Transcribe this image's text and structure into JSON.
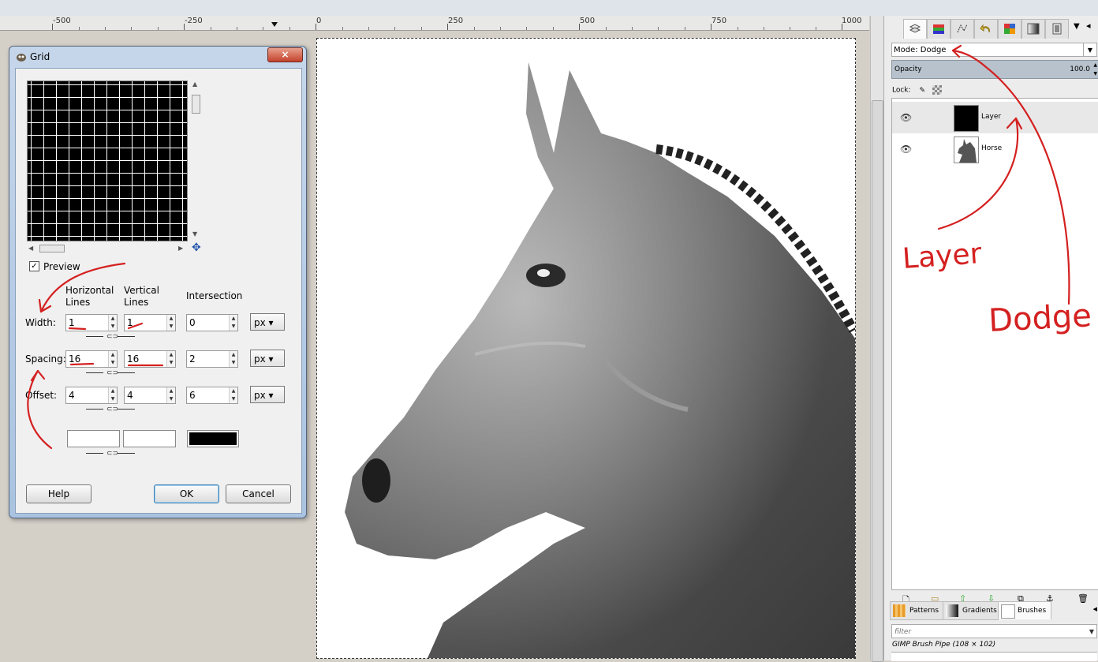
{
  "ruler": {
    "labels": [
      "-500",
      "-250",
      "0",
      "250",
      "500",
      "750",
      "1000"
    ]
  },
  "dialog": {
    "title": "Grid",
    "close_icon": "×",
    "preview_label": "Preview",
    "preview_checked": true,
    "headers": {
      "horizontal": "Horizontal\nLines",
      "vertical": "Vertical\nLines",
      "intersection": "Intersection"
    },
    "rows": {
      "width": {
        "label": "Width:",
        "h": "1",
        "v": "1",
        "i": "0",
        "unit": "px"
      },
      "spacing": {
        "label": "Spacing:",
        "h": "16",
        "v": "16",
        "i": "2",
        "unit": "px"
      },
      "offset": {
        "label": "Offset:",
        "h": "4",
        "v": "4",
        "i": "6",
        "unit": "px"
      }
    },
    "colors": {
      "horizontal": "#ffffff",
      "vertical": "#ffffff",
      "intersection": "#000000"
    },
    "buttons": {
      "help": "Help",
      "ok": "OK",
      "cancel": "Cancel"
    }
  },
  "layers_panel": {
    "mode_label": "Mode: Dodge",
    "opacity_label": "Opacity",
    "opacity_value": "100.0",
    "lock_label": "Lock:",
    "layers": [
      {
        "name": "Layer",
        "visible": true
      },
      {
        "name": "Horse",
        "visible": true
      }
    ]
  },
  "brushes_panel": {
    "tabs": [
      "Patterns",
      "Gradients",
      "Brushes"
    ],
    "filter_placeholder": "filter",
    "brush_name": "GIMP Brush Pipe (108 × 102)"
  },
  "annotations": {
    "layer_note": "Layer",
    "dodge_note": "Dodge"
  },
  "colors": {
    "annotation_red": "#d42020",
    "selection_blue": "#b7c2cc"
  }
}
